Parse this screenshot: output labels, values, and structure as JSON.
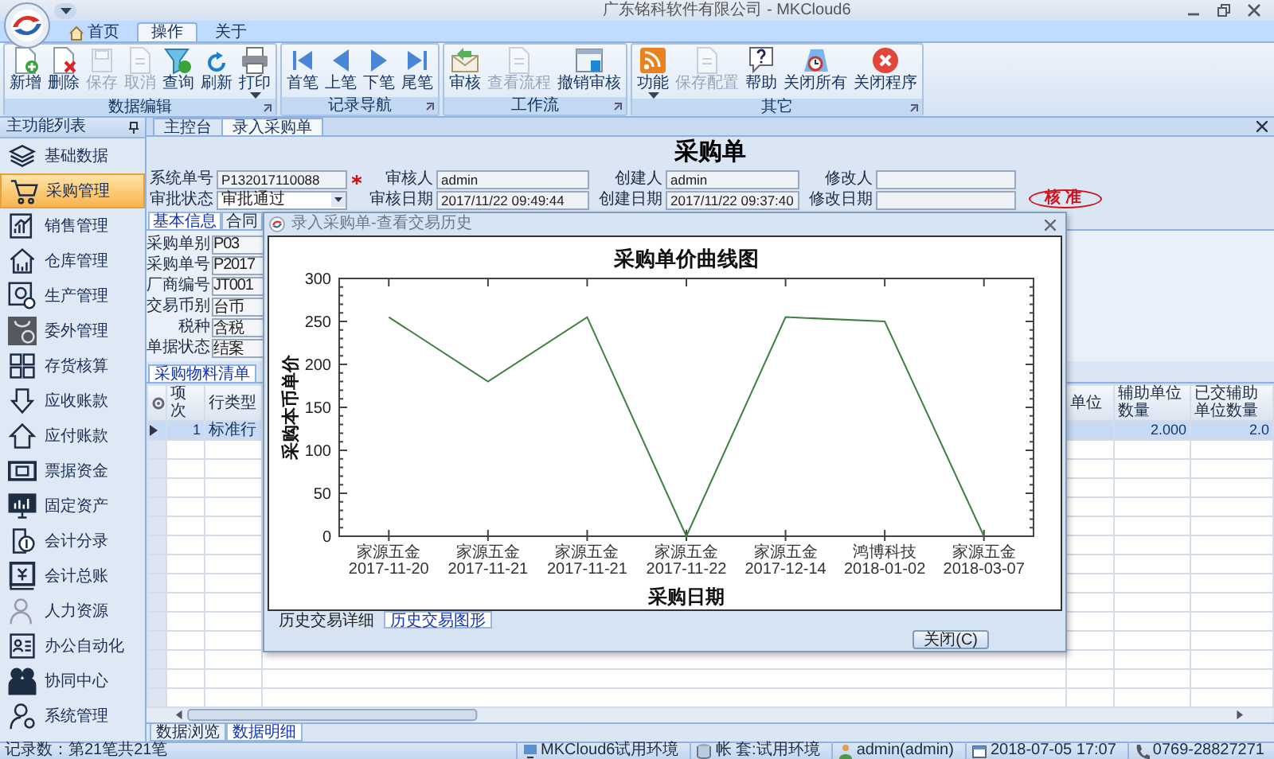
{
  "window": {
    "title": "广东铭科软件有限公司 - MKCloud6"
  },
  "ribbon_tabs": [
    {
      "label": "首页",
      "selected": false
    },
    {
      "label": "操作",
      "selected": true
    },
    {
      "label": "关于",
      "selected": false
    }
  ],
  "ribbon_groups": [
    {
      "label": "数据编辑",
      "buttons": [
        {
          "label": "新增",
          "disabled": false,
          "dropdown": false
        },
        {
          "label": "删除",
          "disabled": false,
          "dropdown": false
        },
        {
          "label": "保存",
          "disabled": true,
          "dropdown": false
        },
        {
          "label": "取消",
          "disabled": true,
          "dropdown": false
        },
        {
          "label": "查询",
          "disabled": false,
          "dropdown": false
        },
        {
          "label": "刷新",
          "disabled": false,
          "dropdown": false
        },
        {
          "label": "打印",
          "disabled": false,
          "dropdown": true
        }
      ]
    },
    {
      "label": "记录导航",
      "buttons": [
        {
          "label": "首笔",
          "disabled": false,
          "dropdown": false
        },
        {
          "label": "上笔",
          "disabled": false,
          "dropdown": false
        },
        {
          "label": "下笔",
          "disabled": false,
          "dropdown": false
        },
        {
          "label": "尾笔",
          "disabled": false,
          "dropdown": false
        }
      ]
    },
    {
      "label": "工作流",
      "buttons": [
        {
          "label": "审核",
          "disabled": false,
          "dropdown": false
        },
        {
          "label": "查看流程",
          "disabled": true,
          "dropdown": false
        },
        {
          "label": "撤销审核",
          "disabled": false,
          "dropdown": false
        }
      ]
    },
    {
      "label": "其它",
      "buttons": [
        {
          "label": "功能",
          "disabled": false,
          "dropdown": true
        },
        {
          "label": "保存配置",
          "disabled": true,
          "dropdown": false
        },
        {
          "label": "帮助",
          "disabled": false,
          "dropdown": false
        },
        {
          "label": "关闭所有",
          "disabled": false,
          "dropdown": false
        },
        {
          "label": "关闭程序",
          "disabled": false,
          "dropdown": false
        }
      ]
    }
  ],
  "sidebar": {
    "title": "主功能列表",
    "items": [
      {
        "label": "基础数据",
        "selected": false
      },
      {
        "label": "采购管理",
        "selected": true
      },
      {
        "label": "销售管理",
        "selected": false
      },
      {
        "label": "仓库管理",
        "selected": false
      },
      {
        "label": "生产管理",
        "selected": false
      },
      {
        "label": "委外管理",
        "selected": false
      },
      {
        "label": "存货核算",
        "selected": false
      },
      {
        "label": "应收账款",
        "selected": false
      },
      {
        "label": "应付账款",
        "selected": false
      },
      {
        "label": "票据资金",
        "selected": false
      },
      {
        "label": "固定资产",
        "selected": false
      },
      {
        "label": "会计分录",
        "selected": false
      },
      {
        "label": "会计总账",
        "selected": false
      },
      {
        "label": "人力资源",
        "selected": false
      },
      {
        "label": "办公自动化",
        "selected": false
      },
      {
        "label": "协同中心",
        "selected": false
      },
      {
        "label": "系统管理",
        "selected": false
      }
    ]
  },
  "doc_tabs": [
    {
      "label": "主控台",
      "selected": false
    },
    {
      "label": "录入采购单",
      "selected": true
    }
  ],
  "form": {
    "title": "采购单",
    "header_rows": [
      [
        {
          "label": "系统单号",
          "kind": "text",
          "value": "P132017110088",
          "required": true
        },
        {
          "label": "审核人",
          "kind": "text",
          "value": "admin",
          "required": false
        },
        {
          "label": "创建人",
          "kind": "text",
          "value": "admin",
          "required": false
        },
        {
          "label": "修改人",
          "kind": "text",
          "required": false
        }
      ],
      [
        {
          "label": "审批状态",
          "kind": "select",
          "value": "审批通过",
          "required": false
        },
        {
          "label": "审核日期",
          "kind": "text",
          "value": "2017/11/22 09:49:44",
          "required": false
        },
        {
          "label": "创建日期",
          "kind": "text",
          "value": "2017/11/22 09:37:40",
          "required": false
        },
        {
          "label": "修改日期",
          "kind": "text",
          "required": false
        }
      ]
    ],
    "stamp": "核准",
    "detail_tabs": [
      {
        "label": "基本信息",
        "selected": true
      },
      {
        "label": "合同",
        "selected": false
      }
    ],
    "detail_fields": [
      {
        "label": "采购单别",
        "value": "P03"
      },
      {
        "label": "采购单号",
        "value": "P2017"
      },
      {
        "label": "厂商编号",
        "value": "JT001"
      },
      {
        "label": "交易币别",
        "value": "台币"
      },
      {
        "label": "税种",
        "value": "含税"
      },
      {
        "label": "单据状态",
        "value": "结案"
      }
    ]
  },
  "grid": {
    "tab": "采购物料清单",
    "columns": [
      {
        "label": "项次"
      },
      {
        "label": "行类型"
      },
      {
        "label": "单位"
      },
      {
        "label": "辅助单位数量"
      },
      {
        "label": "已交辅助单位数量"
      }
    ],
    "rows": [
      {
        "values": [
          "1",
          "标准行",
          "2.000",
          "2.0"
        ],
        "selected": true
      }
    ]
  },
  "bottom_tabs": [
    {
      "label": "数据浏览",
      "selected": false
    },
    {
      "label": "数据明细",
      "selected": true
    }
  ],
  "status_bar": {
    "record": "记录数：第21笔共21笔",
    "items": [
      "MKCloud6试用环境",
      "帐 套:试用环境",
      "admin(admin)",
      "2018-07-05 17:07",
      "0769-28827271"
    ]
  },
  "dialog": {
    "title": "录入采购单-查看交易历史",
    "chart_data": {
      "type": "line",
      "title": "采购单价曲线图",
      "xlabel": "采购日期",
      "ylabel": "采购本币单价",
      "categories": [
        "家源五金\n2017-11-20",
        "家源五金\n2017-11-21",
        "家源五金\n2017-11-21",
        "家源五金\n2017-11-22",
        "家源五金\n2017-12-14",
        "鸿博科技\n2018-01-02",
        "家源五金\n2018-03-07"
      ],
      "series": [
        {
          "color": "#3f7f3f",
          "values": [
            255,
            180,
            255,
            0,
            255,
            250,
            0
          ]
        }
      ],
      "ylim": [
        0,
        300
      ],
      "yticks": [
        0,
        50,
        100,
        150,
        200,
        250,
        300
      ]
    },
    "tabs": [
      {
        "label": "历史交易详细",
        "selected": false
      },
      {
        "label": "历史交易图形",
        "selected": true
      }
    ],
    "close_button": "关闭(C)"
  }
}
